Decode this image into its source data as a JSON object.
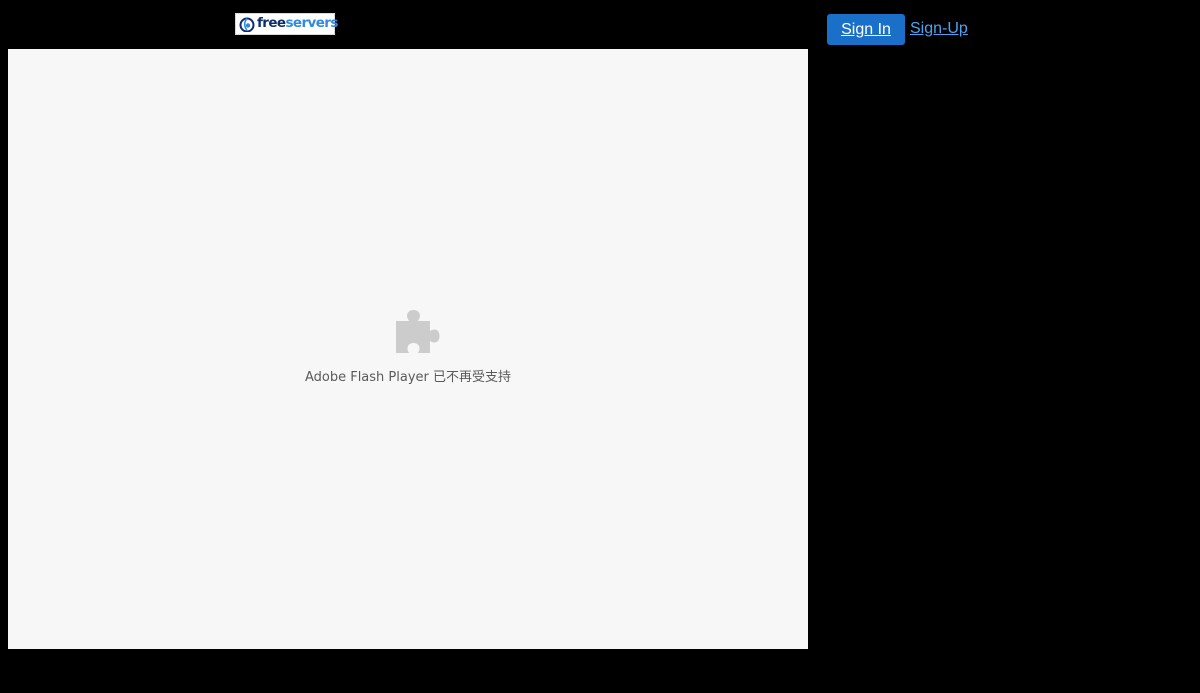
{
  "header": {
    "logo": {
      "text_part1": "free",
      "text_part2": "servers",
      "icon": "freeservers-logo-icon"
    },
    "auth": {
      "sign_in_label": "Sign In",
      "sign_up_label": "Sign-Up"
    }
  },
  "plugin": {
    "icon": "puzzle-piece-icon",
    "message": "Adobe Flash Player 已不再受支持"
  },
  "colors": {
    "background": "#000000",
    "sign_in_button": "#1a6fc8",
    "sign_up_link": "#4da3ef",
    "plugin_area": "#f7f7f7",
    "plugin_icon": "#cccccc",
    "plugin_text": "#5a5a5a"
  }
}
